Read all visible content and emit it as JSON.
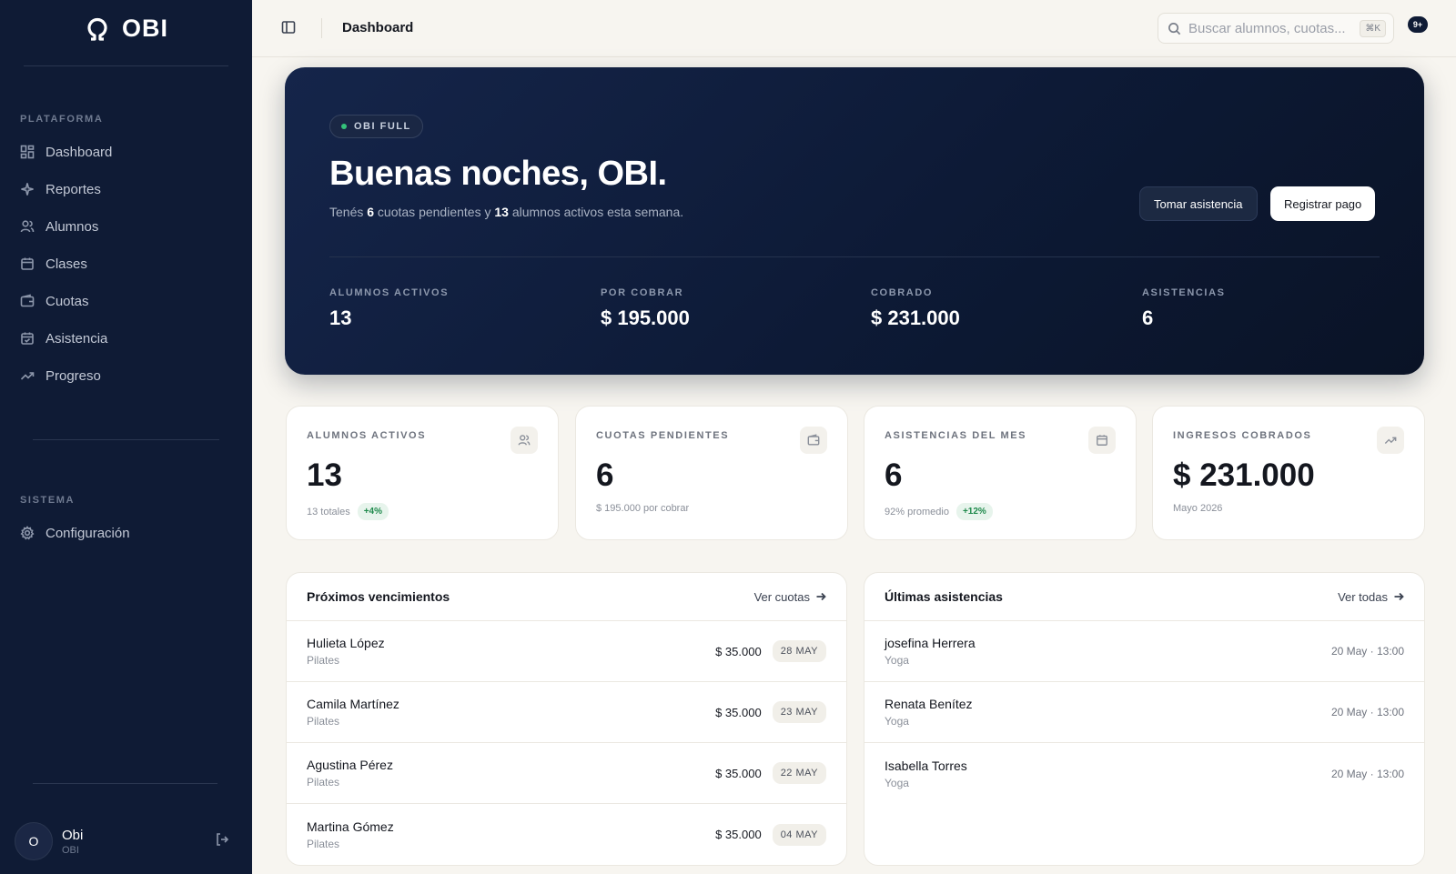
{
  "app": {
    "name": "OBI"
  },
  "sidebar": {
    "sections": [
      {
        "label": "PLATAFORMA",
        "items": [
          {
            "label": "Dashboard",
            "icon": "grid-icon"
          },
          {
            "label": "Reportes",
            "icon": "sparkles-icon"
          },
          {
            "label": "Alumnos",
            "icon": "users-icon"
          },
          {
            "label": "Clases",
            "icon": "calendar-icon"
          },
          {
            "label": "Cuotas",
            "icon": "wallet-icon"
          },
          {
            "label": "Asistencia",
            "icon": "calendar-check-icon"
          },
          {
            "label": "Progreso",
            "icon": "trending-up-icon"
          }
        ]
      },
      {
        "label": "SISTEMA",
        "items": [
          {
            "label": "Configuración",
            "icon": "gear-icon"
          }
        ]
      }
    ],
    "user": {
      "initial": "O",
      "name": "Obi",
      "role": "OBI"
    }
  },
  "header": {
    "title": "Dashboard",
    "search_placeholder": "Buscar alumnos, cuotas...",
    "search_shortcut": "⌘K",
    "notifications": "9+"
  },
  "hero": {
    "plan": "OBI FULL",
    "greeting": "Buenas noches, OBI.",
    "subtitle": {
      "pre": "Tenés ",
      "pending": "6",
      "mid": " cuotas pendientes y ",
      "active": "13",
      "post": " alumnos activos esta semana."
    },
    "btn_attendance": "Tomar asistencia",
    "btn_payment": "Registrar pago",
    "stats": [
      {
        "label": "ALUMNOS ACTIVOS",
        "value": "13"
      },
      {
        "label": "POR COBRAR",
        "value": "$ 195.000"
      },
      {
        "label": "COBRADO",
        "value": "$ 231.000"
      },
      {
        "label": "ASISTENCIAS",
        "value": "6"
      }
    ]
  },
  "cards": [
    {
      "label": "ALUMNOS ACTIVOS",
      "value": "13",
      "foot": "13 totales",
      "badge": "+4%",
      "icon": "users-icon"
    },
    {
      "label": "CUOTAS PENDIENTES",
      "value": "6",
      "foot": "$ 195.000 por cobrar",
      "badge": "",
      "icon": "wallet-icon"
    },
    {
      "label": "ASISTENCIAS DEL MES",
      "value": "6",
      "foot": "92% promedio",
      "badge": "+12%",
      "icon": "calendar-icon"
    },
    {
      "label": "INGRESOS COBRADOS",
      "value": "$ 231.000",
      "foot": "Mayo 2026",
      "badge": "",
      "icon": "trending-up-icon"
    }
  ],
  "upcoming": {
    "title": "Próximos vencimientos",
    "link": "Ver cuotas",
    "rows": [
      {
        "name": "Hulieta López",
        "class": "Pilates",
        "amount": "$ 35.000",
        "date": "28 MAY"
      },
      {
        "name": "Camila Martínez",
        "class": "Pilates",
        "amount": "$ 35.000",
        "date": "23 MAY"
      },
      {
        "name": "Agustina Pérez",
        "class": "Pilates",
        "amount": "$ 35.000",
        "date": "22 MAY"
      },
      {
        "name": "Martina Gómez",
        "class": "Pilates",
        "amount": "$ 35.000",
        "date": "04 MAY"
      }
    ]
  },
  "attendance": {
    "title": "Últimas asistencias",
    "link": "Ver todas",
    "rows": [
      {
        "name": "josefina Herrera",
        "class": "Yoga",
        "time": "20 May · 13:00"
      },
      {
        "name": "Renata Benítez",
        "class": "Yoga",
        "time": "20 May · 13:00"
      },
      {
        "name": "Isabella Torres",
        "class": "Yoga",
        "time": "20 May · 13:00"
      }
    ]
  }
}
